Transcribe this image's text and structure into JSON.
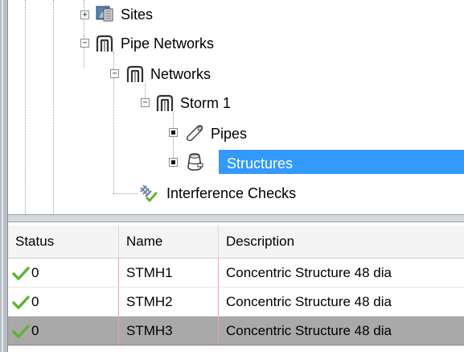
{
  "tree": {
    "nodes": [
      {
        "label": "Sites",
        "expander": "+",
        "icon": "sites-icon"
      },
      {
        "label": "Pipe Networks",
        "expander": "-",
        "icon": "pipe-network-icon"
      },
      {
        "label": "Networks",
        "expander": "-",
        "icon": "pipe-network-icon"
      },
      {
        "label": "Storm 1",
        "expander": "-",
        "icon": "pipe-network-icon"
      },
      {
        "label": "Pipes",
        "expander": "dot",
        "icon": "pipe-icon"
      },
      {
        "label": "Structures",
        "expander": "dot",
        "icon": "structure-icon",
        "selected": true
      },
      {
        "label": "Interference Checks",
        "expander": "",
        "icon": "interference-check-icon"
      }
    ]
  },
  "grid": {
    "columns": [
      "Status",
      "Name",
      "Description"
    ],
    "rows": [
      {
        "status": "0",
        "name": "STMH1",
        "description": "Concentric Structure 48 dia"
      },
      {
        "status": "0",
        "name": "STMH2",
        "description": "Concentric Structure 48 dia"
      },
      {
        "status": "0",
        "name": "STMH3",
        "description": "Concentric Structure 48 dia",
        "selected": true
      }
    ]
  },
  "colors": {
    "selection": "#3399ff",
    "row_selection": "#a9a9a9",
    "check": "#5fb336"
  }
}
